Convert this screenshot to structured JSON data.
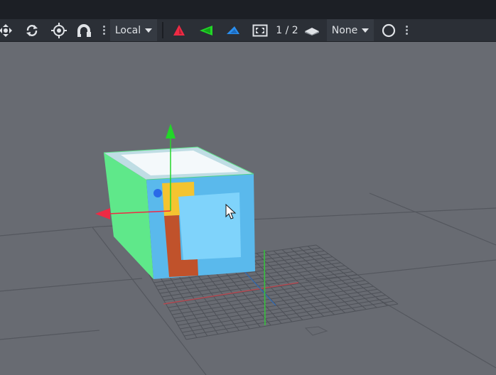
{
  "toolbar": {
    "transform_space": "Local",
    "snap_mode": "None",
    "layer_counter": "1 / 2",
    "icons": {
      "move": "move-icon",
      "rotate": "rotate-icon",
      "pivot": "pivot-target-icon",
      "snap": "magnet-icon",
      "axis_x": "x-axis-plane-icon",
      "axis_y": "y-axis-plane-icon",
      "axis_z": "z-axis-plane-icon",
      "frame": "frame-selection-icon",
      "layer": "layer-icon",
      "shading": "shading-circle-icon"
    },
    "axis_colors": {
      "x": "#ee2a44",
      "y": "#22d628",
      "z": "#2a8ff0"
    }
  },
  "viewport": {
    "object": "textured-cube",
    "cube_colors": {
      "left_face": "#5fe88a",
      "top_face": "#bfdde4",
      "top_inner": "#f4f9fb",
      "front_face": "#5ab9ec",
      "front_inner": "#7fd3fb",
      "yellow_block": "#f4c430",
      "orange_block": "#c0522b"
    }
  }
}
